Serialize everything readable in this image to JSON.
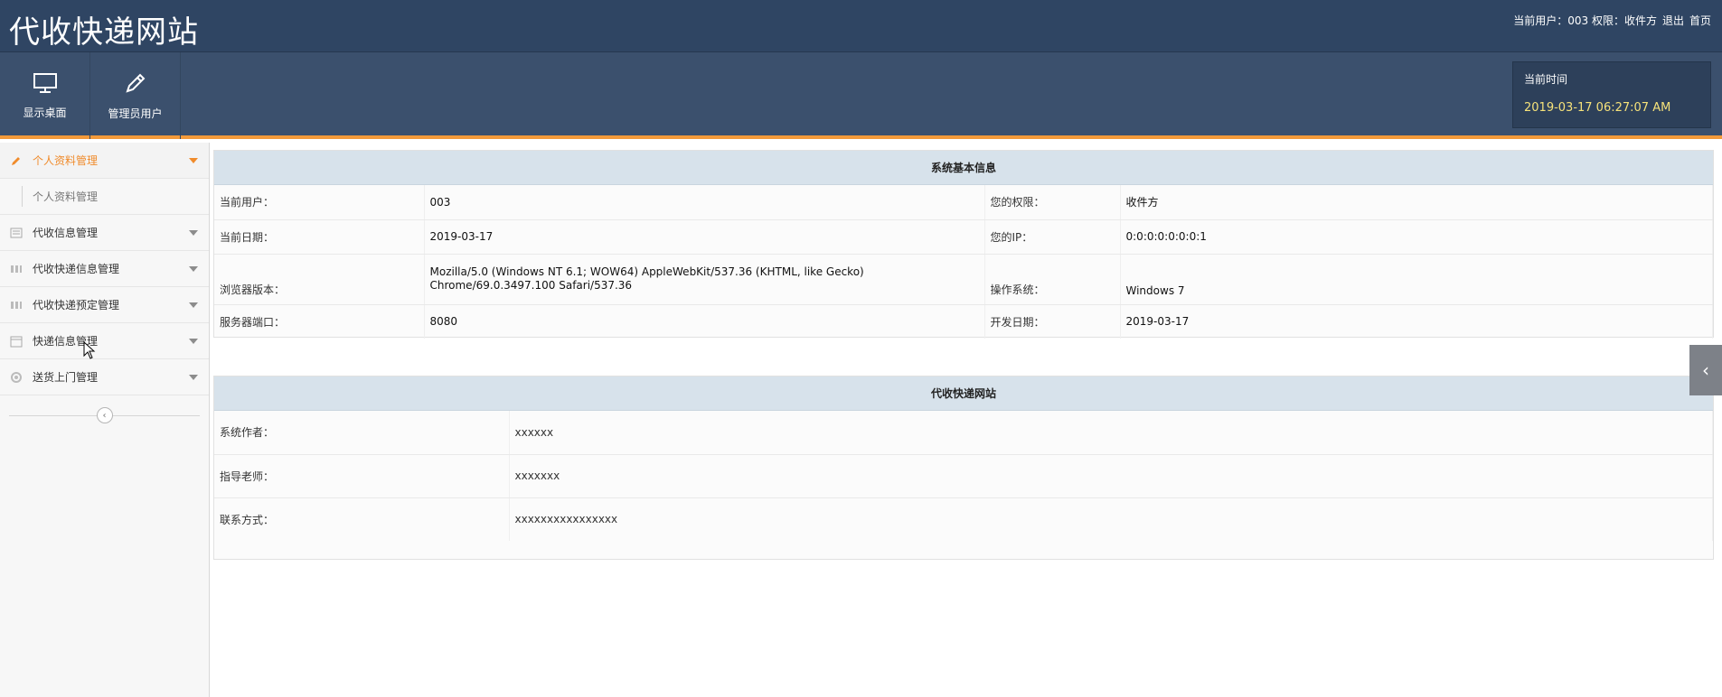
{
  "header": {
    "app_title": "代收快递网站",
    "current_user_label": "当前用户：003 权限：收件方",
    "logout_label": "退出",
    "home_label": "首页"
  },
  "toolbar": {
    "buttons": [
      {
        "label": "显示桌面",
        "icon": "monitor-icon"
      },
      {
        "label": "管理员用户",
        "icon": "pencil-icon"
      }
    ],
    "time_label": "当前时间",
    "time_value": "2019-03-17 06:27:07 AM"
  },
  "sidebar": {
    "active_menu": {
      "label": "个人资料管理",
      "icon": "pencil-icon"
    },
    "submenu": [
      {
        "label": "个人资料管理"
      }
    ],
    "menus": [
      {
        "label": "代收信息管理",
        "icon": "list-icon"
      },
      {
        "label": "代收快递信息管理",
        "icon": "bars-icon"
      },
      {
        "label": "代收快递预定管理",
        "icon": "bars-icon"
      },
      {
        "label": "快递信息管理",
        "icon": "calendar-icon"
      },
      {
        "label": "送货上门管理",
        "icon": "gear-icon"
      }
    ]
  },
  "system_info": {
    "title": "系统基本信息",
    "rows": [
      {
        "k1": "当前用户：",
        "v1": "003",
        "k2": "您的权限：",
        "v2": "收件方"
      },
      {
        "k1": "当前日期：",
        "v1": "2019-03-17",
        "k2": "您的IP：",
        "v2": "0:0:0:0:0:0:0:1"
      },
      {
        "k1": "浏览器版本：",
        "v1": "Mozilla/5.0 (Windows NT 6.1; WOW64) AppleWebKit/537.36 (KHTML, like Gecko) Chrome/69.0.3497.100 Safari/537.36",
        "k2": "操作系统：",
        "v2": "Windows 7"
      },
      {
        "k1": "服务器端口：",
        "v1": "8080",
        "k2": "开发日期：",
        "v2": "2019-03-17"
      }
    ]
  },
  "site_info": {
    "title": "代收快递网站",
    "rows": [
      {
        "k": "系统作者：",
        "v": "xxxxxx"
      },
      {
        "k": "指导老师：",
        "v": "xxxxxxx"
      },
      {
        "k": "联系方式：",
        "v": "xxxxxxxxxxxxxxxx"
      }
    ]
  },
  "colors": {
    "header_bg": "#2f4563",
    "toolbar_bg": "#3b506d",
    "accent_orange": "#f39a3a",
    "time_value": "#f6e27a",
    "panel_title_bg": "#d7e2eb"
  }
}
